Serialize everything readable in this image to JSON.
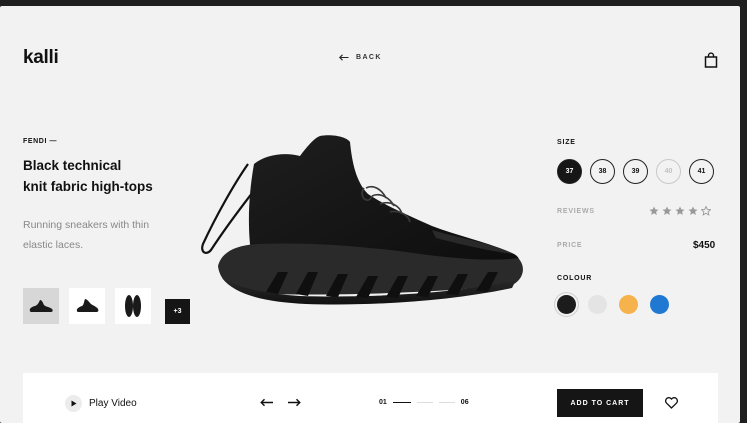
{
  "header": {
    "logo": "kalli",
    "back_label": "BACK"
  },
  "product": {
    "brand": "FENDI —",
    "title_line1": "Black technical",
    "title_line2": "knit fabric high-tops",
    "description": "Running sneakers with thin elastic laces.",
    "thumbnails": [
      "shoe-side",
      "shoe-angle",
      "shoe-soles"
    ],
    "more_count": "+3"
  },
  "options": {
    "size_label": "SIZE",
    "sizes": [
      {
        "value": "37",
        "state": "selected"
      },
      {
        "value": "38",
        "state": "available"
      },
      {
        "value": "39",
        "state": "available"
      },
      {
        "value": "40",
        "state": "disabled"
      },
      {
        "value": "41",
        "state": "available"
      }
    ],
    "reviews_label": "REVIEWS",
    "rating": 4,
    "rating_max": 5,
    "price_label": "PRICE",
    "price": "$450",
    "colour_label": "COLOUR",
    "colours": [
      "#1c1c1c",
      "#e4e4e4",
      "#f6b24c",
      "#1f78d1"
    ],
    "selected_colour_index": 0
  },
  "bar": {
    "play_label": "Play Video",
    "page_start": "01",
    "page_end": "06",
    "add_to_cart": "ADD TO CART"
  }
}
